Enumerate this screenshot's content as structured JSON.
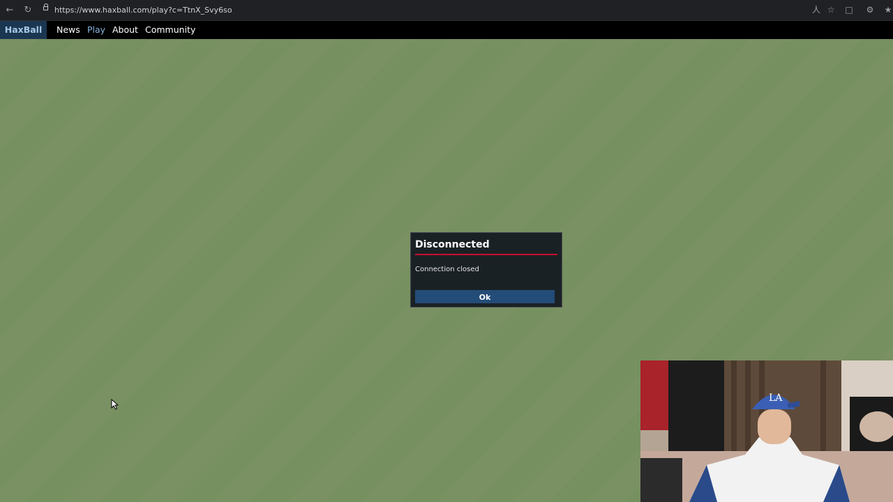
{
  "browser": {
    "url": "https://www.haxball.com/play?c=TtnX_Svy6so",
    "icons": [
      "back-icon",
      "reload-icon",
      "lock-icon",
      "translate-icon",
      "star-icon",
      "extensions-icon",
      "settings-icon",
      "favorites-icon"
    ]
  },
  "nav": {
    "brand": "HaxBall",
    "items": [
      "News",
      "Play",
      "About",
      "Community"
    ]
  },
  "dialog": {
    "title": "Disconnected",
    "message": "Connection closed",
    "ok_label": "Ok"
  },
  "colors": {
    "field_green": "#7a9163",
    "dialog_bg": "#1a2125",
    "title_underline": "#c8102e",
    "ok_button": "#244c78",
    "nav_bg": "#000000",
    "brand_bg": "#1b3650"
  }
}
